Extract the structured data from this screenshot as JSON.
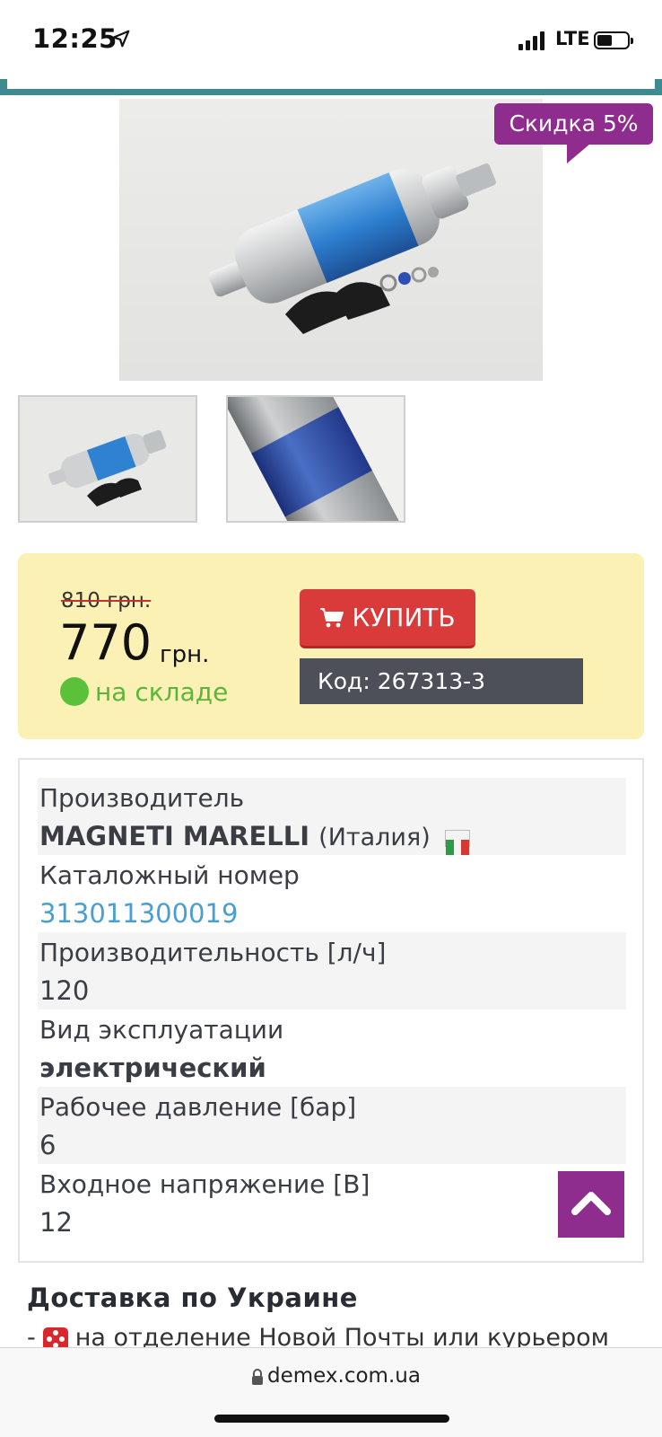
{
  "status_bar": {
    "time": "12:25",
    "network": "LTE"
  },
  "product": {
    "discount_badge": "Скидка 5%",
    "old_price": "810 грн.",
    "new_price": "770",
    "currency": "грн.",
    "stock_status": "на складе",
    "buy_label": "КУПИТЬ",
    "code_label": "Код: 267313-3"
  },
  "specs": [
    {
      "label": "Производитель",
      "value": "MAGNETI MARELLI",
      "extra": "(Италия)"
    },
    {
      "label": "Каталожный номер",
      "value": "313011300019"
    },
    {
      "label": "Производительность [л/ч]",
      "value": "120"
    },
    {
      "label": "Вид эксплуатации",
      "value": "электрический"
    },
    {
      "label": "Рабочее давление [бар]",
      "value": "6"
    },
    {
      "label": "Входное напряжение [В]",
      "value": "12"
    }
  ],
  "delivery": {
    "title": "Доставка по Украине",
    "line_prefix": "-",
    "line_text": "на отделение Новой Почты или курьером"
  },
  "browser": {
    "url": "demex.com.ua"
  },
  "colors": {
    "accent_purple": "#8e2d8e",
    "buy_red": "#d93a3a",
    "price_panel_bg": "#fbf1b5",
    "stock_green": "#5cc13a",
    "link_blue": "#4a9fd0",
    "teal": "#3d8a93"
  },
  "icons": {
    "nav": "location-arrow-icon",
    "cart": "cart-icon",
    "scroll_top": "chevron-up-icon",
    "lock": "lock-icon",
    "delivery": "nova-poshta-icon"
  }
}
